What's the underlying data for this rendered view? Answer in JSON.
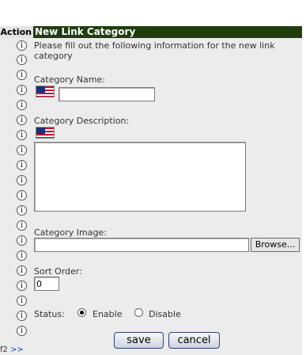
{
  "column": {
    "action_header": "Action"
  },
  "info_icon_glyph": "i",
  "panel": {
    "title": "New Link Category",
    "intro_line1": "Please fill out the following information for the new link",
    "intro_line2": "category"
  },
  "form": {
    "category_name_label": "Category Name:",
    "category_name_value": "",
    "category_description_label": "Category Description:",
    "category_description_value": "",
    "category_image_label": "Category Image:",
    "category_image_value": "",
    "browse_label": "Browse...",
    "sort_order_label": "Sort Order:",
    "sort_order_value": "0",
    "status_label": "Status:",
    "status_options": [
      "Enable",
      "Disable"
    ],
    "status_selected": "Enable"
  },
  "actions": {
    "save_label": "save",
    "cancel_label": "cancel"
  },
  "pager": {
    "page_text": "f2",
    "next_label": ">>"
  },
  "colors": {
    "header_bg": "#1f3d0f",
    "panel_bg": "#ececec",
    "button_border": "#2d3f7a"
  }
}
